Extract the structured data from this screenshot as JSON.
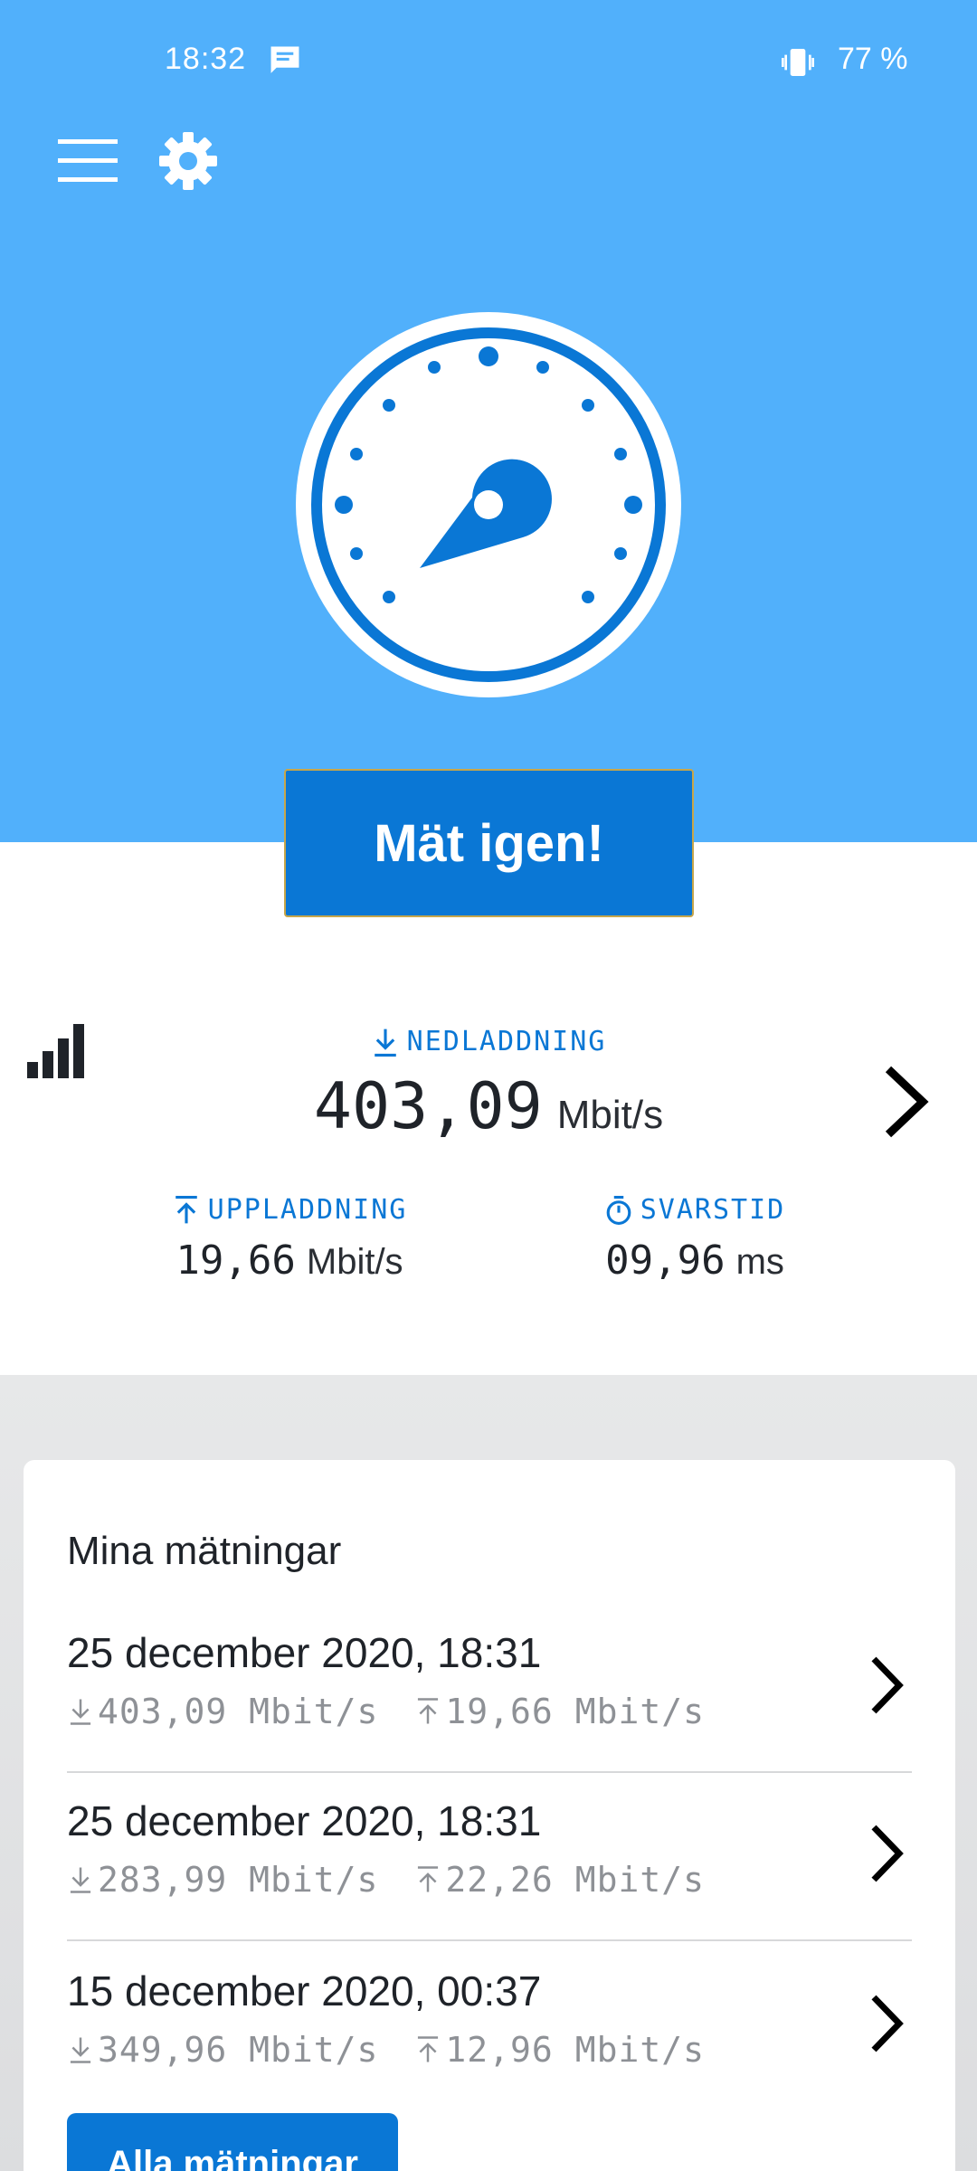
{
  "status_bar": {
    "time": "18:32",
    "battery": "77 %"
  },
  "colors": {
    "hero_blue": "#51b0fb",
    "primary": "#0a77d5"
  },
  "header": {
    "menu_icon": "hamburger-menu-icon",
    "settings_icon": "gear-icon"
  },
  "gauge": {
    "icon": "speedometer-gauge-icon"
  },
  "actions": {
    "retest_label": "Mät igen!",
    "all_measurements_label": "Alla mätningar"
  },
  "result": {
    "download": {
      "label": "NEDLADDNING",
      "value": "403,09",
      "unit": "Mbit/s"
    },
    "upload": {
      "label": "UPPLADDNING",
      "value": "19,66",
      "unit": "Mbit/s"
    },
    "ping": {
      "label": "SVARSTID",
      "value": "09,96",
      "unit": "ms"
    }
  },
  "history": {
    "title": "Mina mätningar",
    "items": [
      {
        "date": "25 december 2020, 18:31",
        "down": "403,09 Mbit/s",
        "up": "19,66 Mbit/s"
      },
      {
        "date": "25 december 2020, 18:31",
        "down": "283,99 Mbit/s",
        "up": "22,26 Mbit/s"
      },
      {
        "date": "15 december 2020, 00:37",
        "down": "349,96 Mbit/s",
        "up": "12,96 Mbit/s"
      }
    ]
  }
}
